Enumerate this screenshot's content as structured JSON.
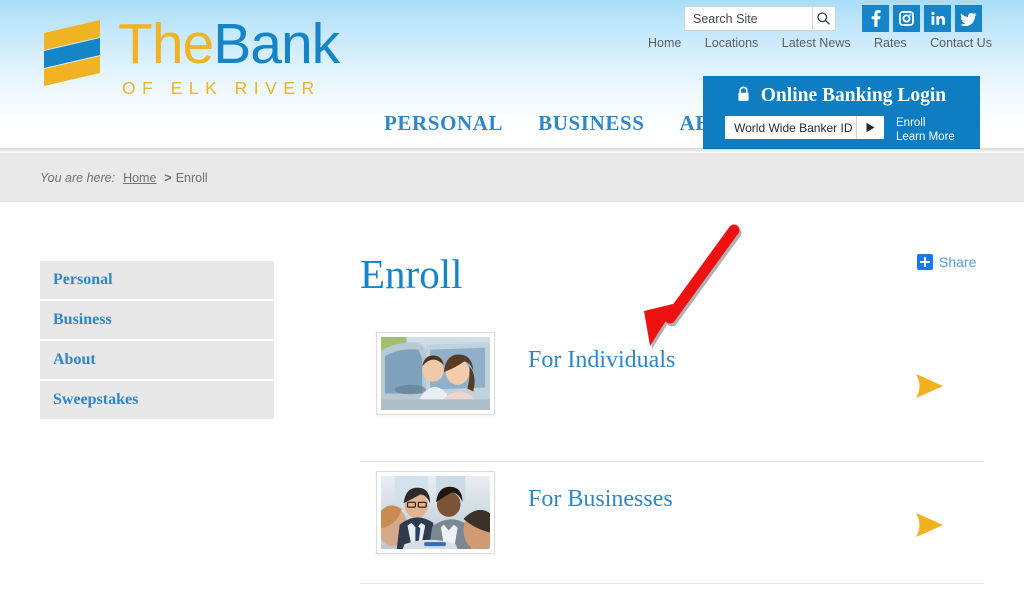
{
  "header": {
    "logo": {
      "the": "The",
      "bank": "Bank",
      "subtitle": "OF ELK RIVER",
      "gold": "#f0b323",
      "blue": "#1585c8"
    },
    "search": {
      "placeholder": "Search Site",
      "value": "",
      "button_icon": "search-icon"
    },
    "social": [
      {
        "name": "facebook",
        "glyph": "f",
        "label": "Facebook"
      },
      {
        "name": "instagram",
        "glyph": "▣",
        "label": "Instagram"
      },
      {
        "name": "linkedin",
        "glyph": "in",
        "label": "LinkedIn"
      },
      {
        "name": "twitter",
        "glyph": "ᴠ",
        "label": "Twitter"
      }
    ],
    "utility_nav": [
      {
        "label": "Home"
      },
      {
        "label": "Locations"
      },
      {
        "label": "Latest News"
      },
      {
        "label": "Rates"
      },
      {
        "label": "Contact Us"
      }
    ],
    "main_nav": [
      {
        "label": "PERSONAL"
      },
      {
        "label": "BUSINESS"
      },
      {
        "label": "ABOUT"
      }
    ],
    "online_banking": {
      "title": "Online Banking Login",
      "lock_icon": "lock-icon",
      "select_value": "World Wide Banker ID",
      "go_label": "▶",
      "enroll_label": "Enroll",
      "learn_more_label": "Learn More",
      "background": "#0f7dc2"
    }
  },
  "breadcrumb": {
    "prefix": "You are here:",
    "home_label": "Home",
    "separator": ">",
    "current": "Enroll"
  },
  "sidebar": {
    "items": [
      {
        "label": "Personal"
      },
      {
        "label": "Business"
      },
      {
        "label": "About"
      },
      {
        "label": "Sweepstakes"
      }
    ]
  },
  "main": {
    "title": "Enroll",
    "share": {
      "label": "Share",
      "icon": "plus-icon",
      "color": "#1877f2"
    },
    "rows": [
      {
        "label": "For Individuals",
        "thumb_alt": "couple-in-car-photo",
        "arrow_icon": "gold-arrow-icon"
      },
      {
        "label": "For Businesses",
        "thumb_alt": "business-meeting-photo",
        "arrow_icon": "gold-arrow-icon"
      }
    ]
  },
  "annotation": {
    "arrow_color": "#ee1111",
    "points_to": "For Individuals"
  }
}
